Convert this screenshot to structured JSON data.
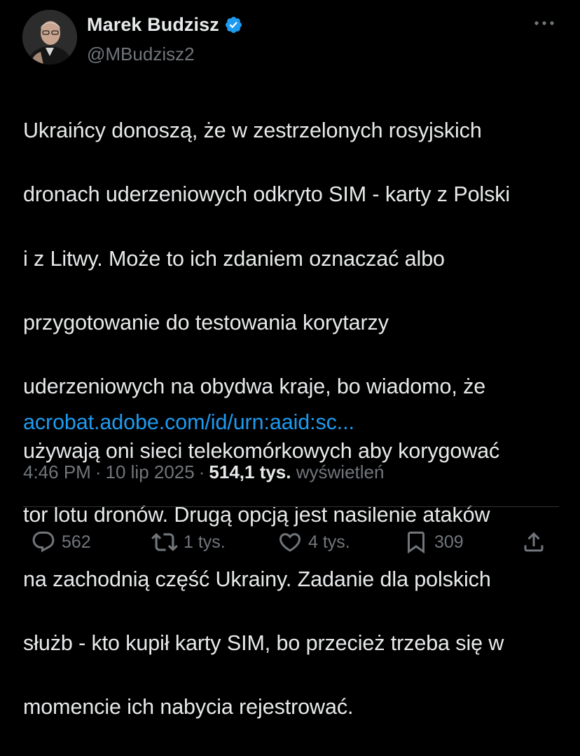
{
  "author": {
    "display_name": "Marek Budzisz",
    "handle": "@MBudzisz2",
    "verified": true
  },
  "tweet": {
    "text_lines": [
      "Ukraińcy donoszą, że w zestrzelonych rosyjskich",
      "dronach uderzeniowych odkryto SIM - karty z Polski",
      "i z Litwy. Może to ich zdaniem oznaczać albo",
      "przygotowanie do testowania korytarzy",
      "uderzeniowych na obydwa kraje, bo wiadomo, że",
      "używają oni sieci telekomórkowych aby korygować",
      "tor lotu dronów. Drugą opcją jest nasilenie ataków",
      "na zachodnią część Ukrainy. Zadanie dla polskich",
      "służb - kto kupił karty SIM, bo przecież trzeba się w",
      "momencie ich nabycia rejestrować."
    ],
    "link": "acrobat.adobe.com/id/urn:aaid:sc..."
  },
  "meta": {
    "time": "4:46 PM",
    "date": "10 lip 2025",
    "separator": "·",
    "views_count": "514,1 tys.",
    "views_label": "wyświetleń"
  },
  "actions": {
    "replies": "562",
    "reposts": "1 tys.",
    "likes": "4 tys.",
    "bookmarks": "309"
  },
  "icons": {
    "verified": "verified-badge-icon",
    "more": "more-horizontal-icon",
    "reply": "reply-icon",
    "repost": "repost-icon",
    "like": "heart-icon",
    "bookmark": "bookmark-icon",
    "share": "share-icon"
  },
  "colors": {
    "background": "#000000",
    "text": "#e7e9ea",
    "secondary": "#71767b",
    "link": "#1d9bf0",
    "divider": "#2f3336"
  }
}
